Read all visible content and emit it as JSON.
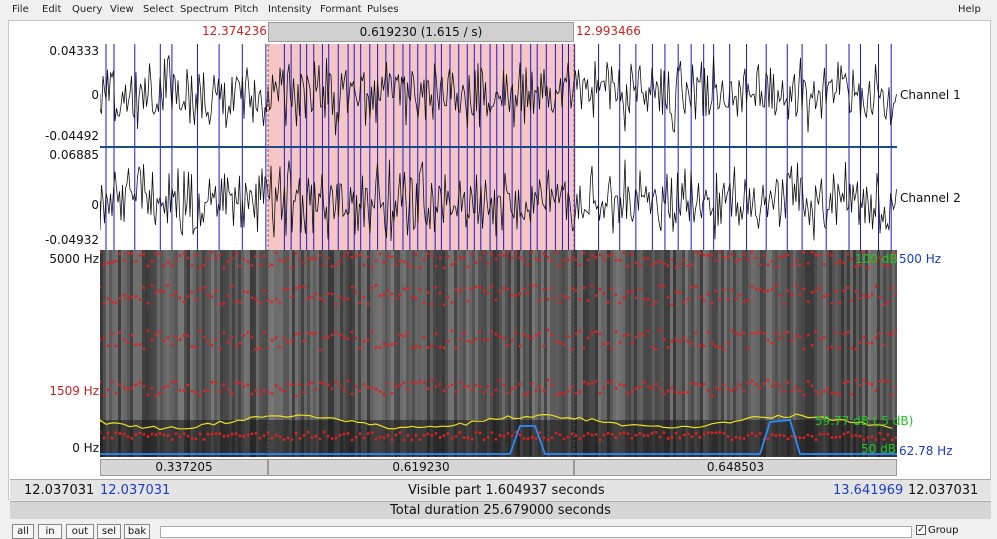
{
  "menu": [
    "File",
    "Edit",
    "Query",
    "View",
    "Select",
    "Spectrum",
    "Pitch",
    "Intensity",
    "Formant",
    "Pulses",
    "Help"
  ],
  "selection": {
    "start": "12.374236",
    "duration": "0.619230 (1.615 / s)",
    "end": "12.993466"
  },
  "waveform": {
    "ch1": {
      "label": "Channel 1",
      "ymax": "0.04333",
      "yzero": "0",
      "ymin": "-0.04492"
    },
    "ch2": {
      "label": "Channel 2",
      "ymax": "0.06885",
      "yzero": "0",
      "ymin": "-0.04932"
    }
  },
  "spectrogram": {
    "ytop": "5000 Hz",
    "ymid": "1509 Hz",
    "ybottom": "0 Hz",
    "pitch_top": "500 Hz",
    "pitch_bottom": "62.78 Hz",
    "int_top": "100 dB",
    "int_bottom": "50 dB",
    "int_mid": "59.77 dB (.5 dB)"
  },
  "segments": {
    "left": "0.337205",
    "middle": "0.619230",
    "right": "0.648503"
  },
  "visible": {
    "left_outer": "12.037031",
    "left_inner": "12.037031",
    "text": "Visible part 1.604937 seconds",
    "right_inner": "13.641969",
    "right_outer": "12.037031"
  },
  "total": "Total duration 25.679000 seconds",
  "buttons": {
    "all": "all",
    "in": "in",
    "out": "out",
    "sel": "sel",
    "bak": "bak"
  },
  "group": "Group",
  "colors": {
    "selection": "#f6c6c6",
    "pulse": "#1a1acc",
    "formant": "#e02020",
    "pitch": "#2a8cff",
    "intensity": "#e8e020",
    "spectro_bg": "#333333"
  }
}
